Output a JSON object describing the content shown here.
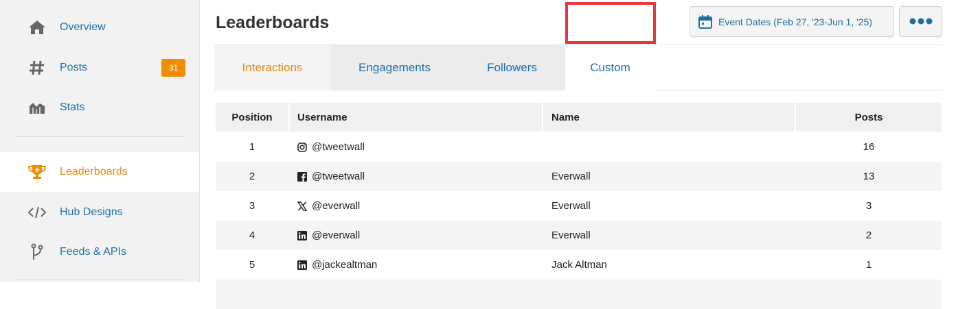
{
  "sidebar": {
    "items": [
      {
        "label": "Overview",
        "icon": "home-icon"
      },
      {
        "label": "Posts",
        "icon": "hash-icon",
        "badge": "31"
      },
      {
        "label": "Stats",
        "icon": "stats-icon"
      },
      {
        "label": "Leaderboards",
        "icon": "trophy-icon",
        "active": true
      },
      {
        "label": "Hub Designs",
        "icon": "code-icon"
      },
      {
        "label": "Feeds & APIs",
        "icon": "branch-icon"
      }
    ]
  },
  "header": {
    "title": "Leaderboards",
    "date_button": "Event Dates (Feb 27, '23-Jun 1, '25)",
    "more_button_icon": "more-dots-icon"
  },
  "tabs": [
    "Interactions",
    "Engagements",
    "Followers",
    "Custom"
  ],
  "table": {
    "columns": [
      "Position",
      "Username",
      "Name",
      "Posts"
    ],
    "rows": [
      {
        "position": "1",
        "network": "instagram-icon",
        "username": "@tweetwall",
        "name": "",
        "posts": "16"
      },
      {
        "position": "2",
        "network": "facebook-icon",
        "username": "@tweetwall",
        "name": "Everwall",
        "posts": "13"
      },
      {
        "position": "3",
        "network": "x-icon",
        "username": "@everwall",
        "name": "Everwall",
        "posts": "3"
      },
      {
        "position": "4",
        "network": "linkedin-icon",
        "username": "@everwall",
        "name": "Everwall",
        "posts": "2"
      },
      {
        "position": "5",
        "network": "linkedin-icon",
        "username": "@jackealtman",
        "name": "Jack Altman",
        "posts": "1"
      }
    ]
  },
  "colors": {
    "accent": "#e8890c",
    "link": "#1f6fa3",
    "highlight": "#e5383b",
    "badge": "#f08c00"
  }
}
